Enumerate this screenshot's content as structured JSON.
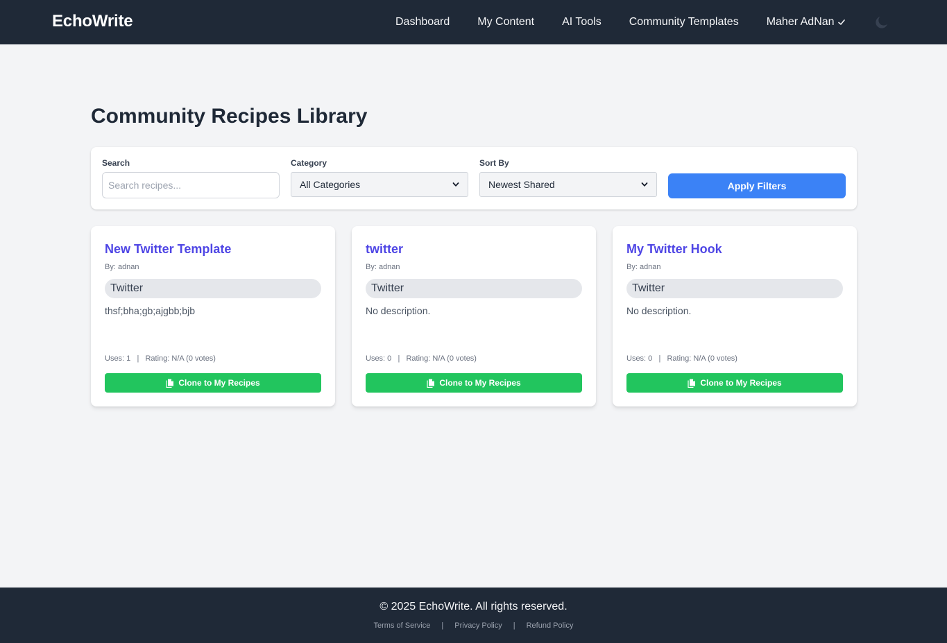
{
  "navbar": {
    "brand": "EchoWrite",
    "links": [
      "Dashboard",
      "My Content",
      "AI Tools",
      "Community Templates"
    ],
    "user_name": "Maher AdNan",
    "theme_icon": "moon-icon"
  },
  "main": {
    "title": "Community Recipes Library",
    "filters": {
      "search_label": "Search",
      "search_placeholder": "Search recipes...",
      "search_value": "",
      "category_label": "Category",
      "category_value": "All Categories",
      "sort_label": "Sort By",
      "sort_value": "Newest Shared",
      "apply_label": "Apply Filters"
    },
    "cards": [
      {
        "title": "New Twitter Template",
        "author": "By: adnan",
        "tag": "Twitter",
        "description": "thsf;bha;gb;ajgbb;bjb",
        "stats": "Uses: 1   |   Rating: N/A (0 votes)",
        "clone_label": "Clone to My Recipes"
      },
      {
        "title": "twitter",
        "author": "By: adnan",
        "tag": "Twitter",
        "description": "No description.",
        "stats": "Uses: 0   |   Rating: N/A (0 votes)",
        "clone_label": "Clone to My Recipes"
      },
      {
        "title": "My Twitter Hook",
        "author": "By: adnan",
        "tag": "Twitter",
        "description": "No description.",
        "stats": "Uses: 0   |   Rating: N/A (0 votes)",
        "clone_label": "Clone to My Recipes"
      }
    ]
  },
  "footer": {
    "copyright": "© 2025 EchoWrite. All rights reserved.",
    "links": [
      "Terms of Service",
      "Privacy Policy",
      "Refund Policy"
    ],
    "separator": "|"
  },
  "colors": {
    "navbar_bg": "#1f2937",
    "page_bg": "#f3f4f6",
    "primary_blue": "#3b82f6",
    "title_indigo": "#4f46e5",
    "clone_green": "#22c55e"
  }
}
